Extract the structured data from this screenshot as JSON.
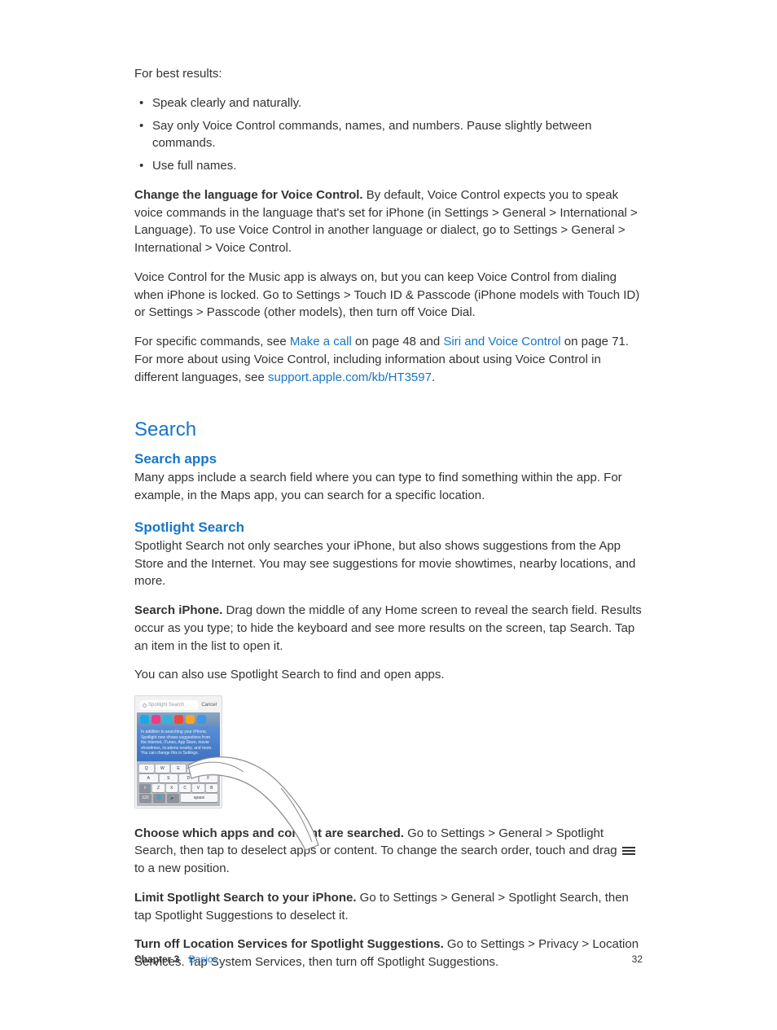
{
  "intro": "For best results:",
  "tips": [
    "Speak clearly and naturally.",
    "Say only Voice Control commands, names, and numbers. Pause slightly between commands.",
    "Use full names."
  ],
  "para_change_lang_bold": "Change the language for Voice Control.",
  "para_change_lang_rest": " By default, Voice Control expects you to speak voice commands in the language that's set for iPhone (in Settings > General > International > Language). To use Voice Control in another language or dialect, go to Settings > General > International > Voice Control.",
  "para_music": "Voice Control for the Music app is always on, but you can keep Voice Control from dialing when iPhone is locked. Go to Settings > Touch ID & Passcode (iPhone models with Touch ID) or Settings > Passcode (other models), then turn off Voice Dial.",
  "para_links_pre": "For specific commands, see ",
  "link_make_call": "Make a call",
  "para_links_mid1": " on page 48 and ",
  "link_siri": "Siri and Voice Control",
  "para_links_mid2": " on page 71. For more about using Voice Control, including information about using Voice Control in different languages, see ",
  "link_support": "support.apple.com/kb/HT3597",
  "para_links_end": ".",
  "section_search": "Search",
  "sub_search_apps": "Search apps",
  "para_search_apps": "Many apps include a search field where you can type to find something within the app. For example, in the Maps app, you can search for a specific location.",
  "sub_spotlight": "Spotlight Search",
  "para_spotlight_intro": "Spotlight Search not only searches your iPhone, but also shows suggestions from the App Store and the Internet. You may see suggestions for movie showtimes, nearby locations, and more.",
  "para_search_iphone_bold": "Search iPhone.",
  "para_search_iphone_rest": " Drag down the middle of any Home screen to reveal the search field. Results occur as you type; to hide the keyboard and see more results on the screen, tap Search. Tap an item in the list to open it.",
  "para_also": "You can also use Spotlight Search to find and open apps.",
  "figure": {
    "search_placeholder": "Spotlight Search",
    "cancel": "Cancel",
    "icon_colors": [
      "#1aa8e8",
      "#e63e8a",
      "#2fb6d9",
      "#f0483a",
      "#f6a623",
      "#3a99e8"
    ],
    "desc": "In addition to searching your iPhone, Spotlight now shows suggestions from the Internet, iTunes, App Store, movie showtimes, locations nearby, and more. You can change this in Settings.",
    "krow1": [
      "Q",
      "W",
      "E",
      "R",
      "T"
    ],
    "krow2": [
      "A",
      "S",
      "D",
      "F"
    ],
    "krow3": [
      "⇧",
      "Z",
      "X",
      "C",
      "V",
      "B"
    ],
    "krow4_space": "space"
  },
  "para_choose_bold": "Choose which apps and content are searched.",
  "para_choose_rest_a": " Go to Settings > General > Spotlight Search, then tap to deselect apps or content. To change the search order, touch and drag ",
  "para_choose_rest_b": " to a new position.",
  "para_limit_bold": "Limit Spotlight Search to your iPhone.",
  "para_limit_rest": " Go to Settings > General > Spotlight Search, then tap Spotlight Suggestions to deselect it.",
  "para_turnoff_bold": "Turn off Location Services for Spotlight Suggestions.",
  "para_turnoff_rest": " Go to Settings > Privacy > Location Services. Tap System Services, then turn off Spotlight Suggestions.",
  "footer": {
    "chapter_label": "Chapter  3",
    "chapter_title": "Basics",
    "page": "32"
  }
}
